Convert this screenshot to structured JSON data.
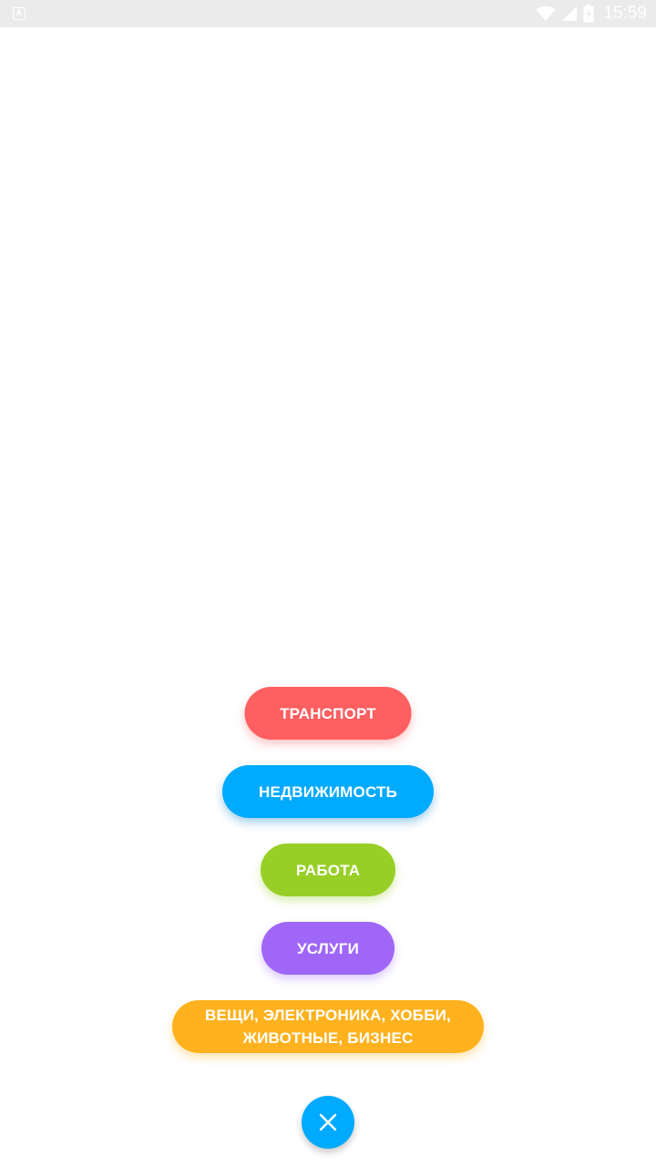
{
  "status_bar": {
    "time": "15:59",
    "left_icon": "A",
    "icons": [
      "wifi-icon",
      "signal-icon",
      "battery-icon"
    ]
  },
  "categories": {
    "transport": "ТРАНСПОРТ",
    "realty": "НЕДВИЖИМОСТЬ",
    "job": "РАБОТА",
    "services": "УСЛУГИ",
    "goods_line1": "ВЕЩИ, ЭЛЕКТРОНИКА, ХОББИ,",
    "goods_line2": "ЖИВОТНЫЕ, БИЗНЕС"
  },
  "fab": {
    "icon": "close-icon"
  },
  "colors": {
    "transport": "#fe5f61",
    "realty": "#00aaff",
    "job": "#97cf26",
    "services": "#9f66f8",
    "goods": "#ffb21e",
    "fab": "#00aaff",
    "status_bar": "#ebebeb"
  }
}
